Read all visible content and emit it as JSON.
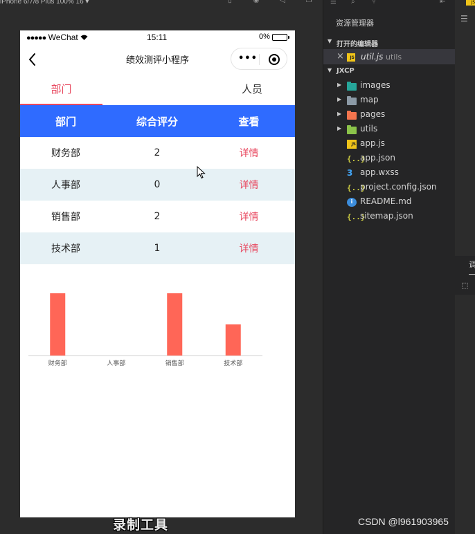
{
  "simulator": {
    "device_label": "iPhone 6/7/8 Plus 100% 16 ▾",
    "toolbar_icons": [
      "phone-icon",
      "record-icon",
      "volume-icon",
      "copy-icon"
    ]
  },
  "status_bar": {
    "carrier": "WeChat",
    "signal": "●●●●●",
    "time": "15:11",
    "battery_pct": "0%"
  },
  "nav": {
    "title": "绩效测评小程序",
    "more": "•••"
  },
  "tabs": [
    {
      "label": "部门",
      "active": true
    },
    {
      "label": "人员",
      "active": false
    }
  ],
  "table": {
    "headers": [
      "部门",
      "综合评分",
      "查看"
    ],
    "rows": [
      {
        "dept": "财务部",
        "score": "2",
        "action": "详情"
      },
      {
        "dept": "人事部",
        "score": "0",
        "action": "详情"
      },
      {
        "dept": "销售部",
        "score": "2",
        "action": "详情"
      },
      {
        "dept": "技术部",
        "score": "1",
        "action": "详情"
      }
    ]
  },
  "chart_data": {
    "type": "bar",
    "categories": [
      "财务部",
      "人事部",
      "销售部",
      "技术部"
    ],
    "values": [
      2,
      0,
      2,
      1
    ],
    "title": "",
    "xlabel": "",
    "ylabel": "",
    "ylim": [
      0,
      2
    ],
    "grid": false,
    "legend": "none",
    "bar_color": "#ff6657"
  },
  "explorer": {
    "header": "资源管理器",
    "open_editors_label": "打开的编辑器",
    "open_file": {
      "name": "util.js",
      "dir": "utils"
    },
    "project_label": "JXCP",
    "items": [
      {
        "label": "images",
        "type": "folder",
        "color": "#26a69a",
        "expandable": true
      },
      {
        "label": "map",
        "type": "folder",
        "color": "#8c9aa6",
        "expandable": true
      },
      {
        "label": "pages",
        "type": "folder",
        "color": "#f4754e",
        "expandable": true
      },
      {
        "label": "utils",
        "type": "folder",
        "color": "#8bc34a",
        "expandable": true
      },
      {
        "label": "app.js",
        "type": "js",
        "expandable": false
      },
      {
        "label": "app.json",
        "type": "json",
        "expandable": false
      },
      {
        "label": "app.wxss",
        "type": "css",
        "expandable": false
      },
      {
        "label": "project.config.json",
        "type": "json",
        "expandable": false
      },
      {
        "label": "README.md",
        "type": "info",
        "expandable": false
      },
      {
        "label": "sitemap.json",
        "type": "json",
        "expandable": false
      }
    ]
  },
  "watermark": {
    "recorder": "录制工具",
    "csdn": "CSDN @l961903965"
  },
  "far_right": {
    "panel_char": "调",
    "js_badge": "JS"
  },
  "colors": {
    "accent_tab": "#e8485f",
    "table_header": "#2f6bff",
    "row_alt": "#e6f1f5",
    "bar": "#ff6657"
  }
}
